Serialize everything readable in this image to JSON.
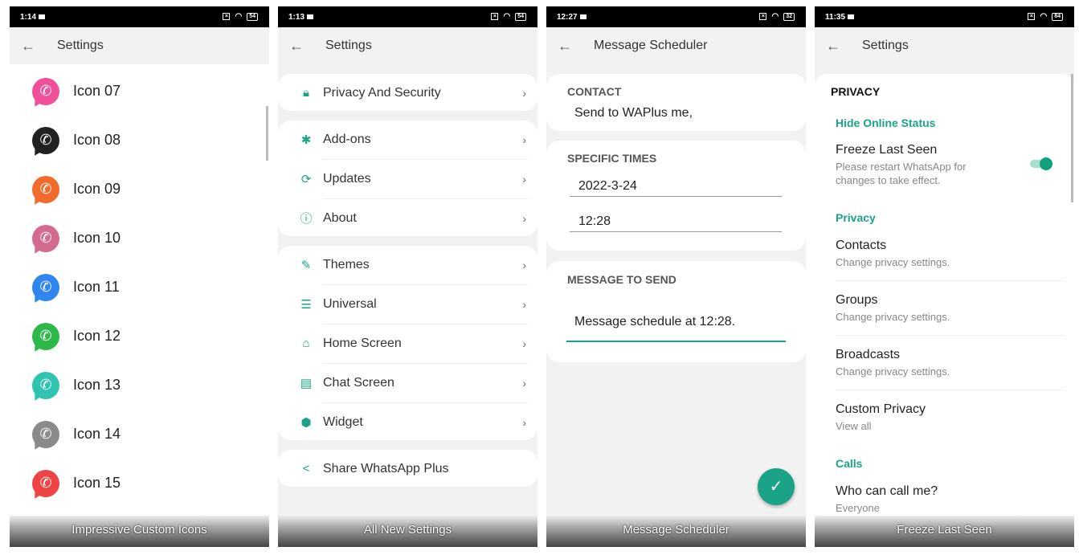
{
  "accent": "#1aa386",
  "panels": [
    {
      "time": "1:14",
      "battery": "54",
      "title": "Settings",
      "caption": "Impressive Custom Icons",
      "icons": [
        {
          "label": "Icon 07",
          "color": "#f0509a"
        },
        {
          "label": "Icon 08",
          "color": "#222222"
        },
        {
          "label": "Icon 09",
          "color": "#f36b2a"
        },
        {
          "label": "Icon 10",
          "color": "#d46a8e"
        },
        {
          "label": "Icon 11",
          "color": "#2f86f0"
        },
        {
          "label": "Icon 12",
          "color": "#2fb84a"
        },
        {
          "label": "Icon 13",
          "color": "#2ec4b0"
        },
        {
          "label": "Icon 14",
          "color": "#8a8a8a"
        },
        {
          "label": "Icon 15",
          "color": "#ef4444"
        }
      ]
    },
    {
      "time": "1:13",
      "battery": "54",
      "title": "Settings",
      "caption": "All New Settings",
      "groups": [
        [
          {
            "label": "Privacy And Security",
            "icon": "lock-icon"
          }
        ],
        [
          {
            "label": "Add-ons",
            "icon": "puzzle-icon"
          },
          {
            "label": "Updates",
            "icon": "refresh-icon"
          },
          {
            "label": "About",
            "icon": "info-icon"
          }
        ],
        [
          {
            "label": "Themes",
            "icon": "brush-icon"
          },
          {
            "label": "Universal",
            "icon": "sliders-icon"
          },
          {
            "label": "Home Screen",
            "icon": "home-icon"
          },
          {
            "label": "Chat Screen",
            "icon": "chat-icon"
          },
          {
            "label": "Widget",
            "icon": "cube-icon"
          }
        ],
        [
          {
            "label": "Share WhatsApp Plus",
            "icon": "share-icon"
          }
        ]
      ]
    },
    {
      "time": "12:27",
      "battery": "32",
      "title": "Message Scheduler",
      "caption": "Message Scheduler",
      "contact_header": "CONTACT",
      "contact_value": "Send to WAPlus me,",
      "times_header": "SPECIFIC TIMES",
      "date": "2022-3-24",
      "time_value": "12:28",
      "message_header": "MESSAGE TO SEND",
      "message": "Message schedule at 12:28."
    },
    {
      "time": "11:35",
      "battery": "84",
      "title": "Settings",
      "caption": "Freeze Last Seen",
      "section": "PRIVACY",
      "hide_online_header": "Hide Online Status",
      "freeze_title": "Freeze Last Seen",
      "freeze_sub": "Please restart WhatsApp for changes to take effect.",
      "freeze_enabled": true,
      "privacy_header": "Privacy",
      "items": [
        {
          "title": "Contacts",
          "sub": "Change privacy settings."
        },
        {
          "title": "Groups",
          "sub": "Change privacy settings."
        },
        {
          "title": "Broadcasts",
          "sub": "Change privacy settings."
        },
        {
          "title": "Custom Privacy",
          "sub": "View all"
        }
      ],
      "calls_header": "Calls",
      "call_title": "Who can call me?",
      "call_sub": "Everyone"
    }
  ]
}
